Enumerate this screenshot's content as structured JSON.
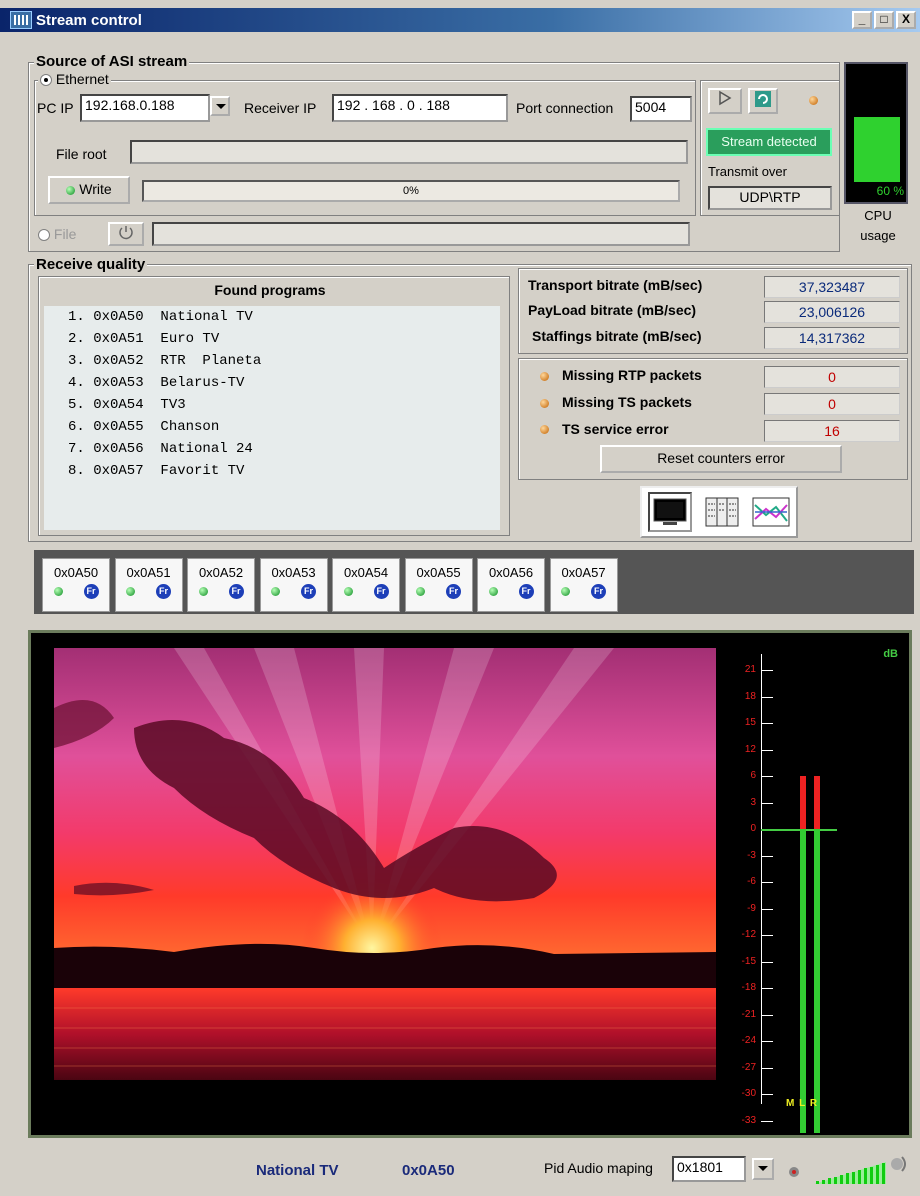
{
  "window": {
    "title": "Stream control",
    "buttons": [
      "_",
      "□",
      "X"
    ]
  },
  "source": {
    "group_label": "Source of ASI stream",
    "ethernet_label": "Ethernet",
    "pc_ip_label": "PC IP",
    "pc_ip_value": "192.168.0.188",
    "receiver_ip_label": "Receiver IP",
    "receiver_ip_value": "192 . 168 .   0  . 188",
    "port_label": "Port connection",
    "port_value": "5004",
    "file_root_label": "File root",
    "file_root_value": "",
    "write_label": "Write",
    "progress_text": "0%",
    "stream_status": "Stream detected",
    "transmit_label": "Transmit over",
    "transmit_value": "UDP\\RTP",
    "file_label": "File",
    "file_value": ""
  },
  "cpu": {
    "value_text": "60 %",
    "level": 0.6,
    "label_line1": "CPU",
    "label_line2": "usage"
  },
  "receive": {
    "group_label": "Receive quality",
    "programs_header": "Found programs",
    "programs": [
      "1. 0x0A50  National TV",
      "2. 0x0A51  Euro TV",
      "3. 0x0A52  RTR  Planeta",
      "4. 0x0A53  Belarus-TV",
      "5. 0x0A54  TV3",
      "6. 0x0A55  Chanson",
      "7. 0x0A56  National 24",
      "8. 0x0A57  Favorit TV"
    ],
    "transport_label": "Transport bitrate (mB/sec)",
    "transport_value": "37,323487",
    "payload_label": "PayLoad bitrate  (mB/sec)",
    "payload_value": "23,006126",
    "staffings_label": "Staffings bitrate  (mB/sec)",
    "staffings_value": "14,317362",
    "missing_rtp_label": "Missing RTP packets",
    "missing_rtp_value": "0",
    "missing_ts_label": "Missing TS  packets",
    "missing_ts_value": "0",
    "ts_error_label": "TS service error",
    "ts_error_value": "16",
    "reset_label": "Reset counters error"
  },
  "tabs": [
    "0x0A50",
    "0x0A51",
    "0x0A52",
    "0x0A53",
    "0x0A54",
    "0x0A55",
    "0x0A56",
    "0x0A57"
  ],
  "tab_badge": "Fr",
  "meter": {
    "unit": "dB",
    "scale": [
      "21",
      "18",
      "15",
      "12",
      "6",
      "3",
      "0",
      "-3",
      "-6",
      "-9",
      "-12",
      "-15",
      "-18",
      "-21",
      "-24",
      "-27",
      "-30",
      "-33"
    ],
    "channels": "M L R",
    "level_db": 6
  },
  "status_bar": {
    "program_name": "National TV",
    "program_pid": "0x0A50",
    "pid_audio_label": "Pid Audio maping",
    "pid_audio_value": "0x1801"
  }
}
